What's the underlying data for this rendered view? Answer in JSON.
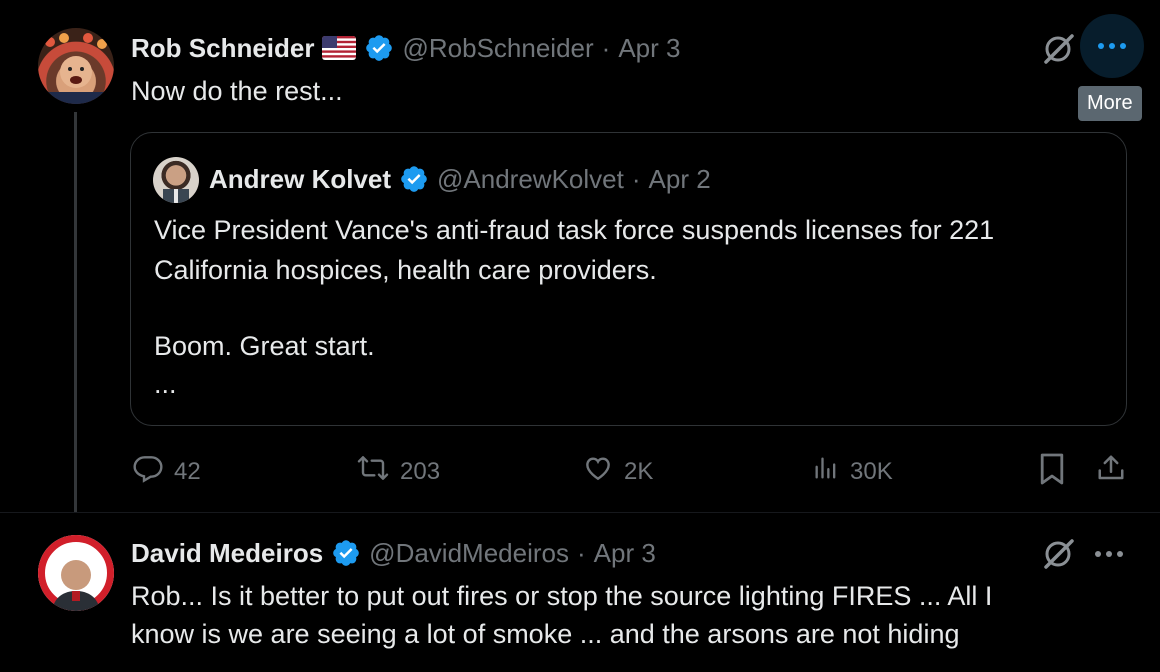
{
  "post1": {
    "author": "Rob Schneider",
    "handle": "@RobSchneider",
    "dot": "·",
    "date": "Apr 3",
    "text": "Now do the rest...",
    "more_tooltip": "More",
    "quote": {
      "author": "Andrew Kolvet",
      "handle": "@AndrewKolvet",
      "dot": "·",
      "date": "Apr 2",
      "line1": "Vice President Vance's anti-fraud task force suspends licenses for 221",
      "line2": "California hospices, health care providers.",
      "line3": "Boom. Great start.",
      "line4": "..."
    },
    "actions": {
      "replies": "42",
      "reposts": "203",
      "likes": "2K",
      "views": "30K"
    }
  },
  "post2": {
    "author": "David Medeiros",
    "handle": "@DavidMedeiros",
    "dot": "·",
    "date": "Apr 3",
    "line1": "Rob... Is it better to put out fires or stop the source lighting FIRES ... All I",
    "line2": "know is we are seeing a lot of smoke ... and the arsons are not hiding"
  },
  "colors": {
    "background": "#000000",
    "text": "#e7e9ea",
    "muted": "#71767b",
    "verified": "#1d9bf0",
    "border": "#2f3336"
  },
  "icons": [
    "flag-us-icon",
    "verified-badge-icon",
    "grok-icon",
    "more-icon",
    "reply-icon",
    "repost-icon",
    "like-icon",
    "views-icon",
    "bookmark-icon",
    "share-icon"
  ]
}
